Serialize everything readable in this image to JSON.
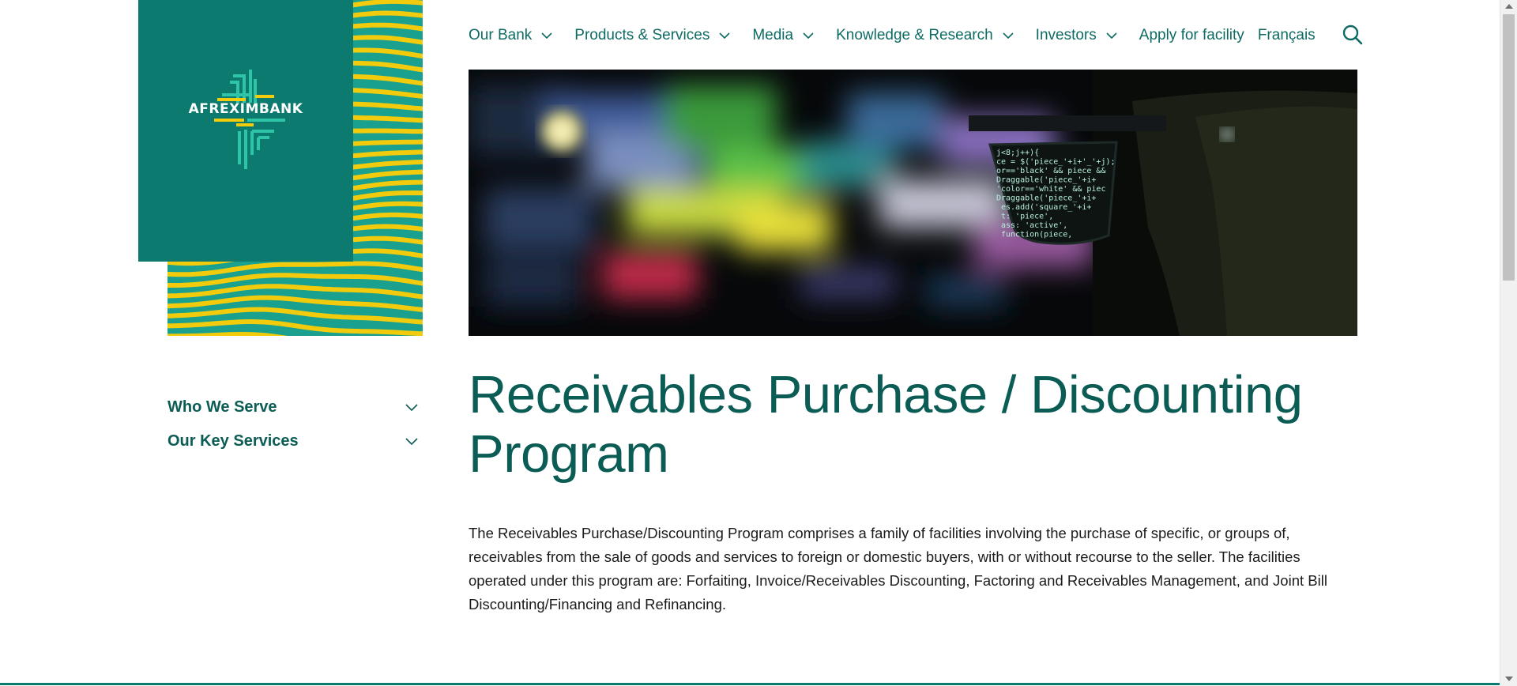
{
  "brand": {
    "name": "AFREXIMBANK",
    "colors": {
      "primary": "#0c7a6f",
      "stripe_yellow": "#f2cc0c",
      "stripe_teal": "#1aa08f",
      "text_dark": "#0b5c55"
    }
  },
  "nav": {
    "items": [
      {
        "label": "Our Bank",
        "has_dropdown": true
      },
      {
        "label": "Products & Services",
        "has_dropdown": true
      },
      {
        "label": "Media",
        "has_dropdown": true
      },
      {
        "label": "Knowledge & Research",
        "has_dropdown": true
      },
      {
        "label": "Investors",
        "has_dropdown": true
      },
      {
        "label": "Apply for facility",
        "has_dropdown": false
      },
      {
        "label": "Français",
        "has_dropdown": false
      }
    ],
    "search_icon": "search-icon"
  },
  "hero": {
    "code_lines": [
      "j<8;j++){",
      "ce = $('piece_'+i+'_'+j);",
      "or=='black' && piece &&",
      "Draggable('piece_'+i+",
      "'color=='white' && piec",
      "Draggable('piece_'+i+",
      "es.add('square_'+i+",
      "t: 'piece',",
      "ass: 'active',",
      "  function(piece,"
    ]
  },
  "side_nav": {
    "items": [
      {
        "label": "Who We Serve"
      },
      {
        "label": "Our Key Services"
      }
    ]
  },
  "main": {
    "title": "Receivables Purchase / Discounting Program",
    "body": "The Receivables Purchase/Discounting Program comprises a family of facilities involving the purchase of specific, or groups of, receivables from the sale of goods and services to foreign or domestic buyers, with or without recourse to the seller. The facilities operated under this program are: Forfaiting, Invoice/Receivables Discounting, Factoring and Receivables Management, and Joint Bill Discounting/Financing and Refinancing."
  }
}
